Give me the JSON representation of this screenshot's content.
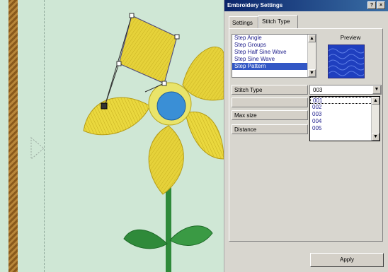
{
  "window": {
    "title": "Embroidery Settings",
    "help_glyph": "?",
    "close_glyph": "×"
  },
  "tabs": [
    {
      "label": "Settings",
      "active": false
    },
    {
      "label": "Stitch Type",
      "active": true
    }
  ],
  "pattern_list": {
    "items": [
      "Step Angle",
      "Step Groups",
      "Step Half Sine Wave",
      "Step Sine Wave",
      "Step Pattern"
    ],
    "selected_index": 4,
    "scroll_up_glyph": "▲",
    "scroll_down_glyph": "▼"
  },
  "preview": {
    "label": "Preview",
    "color": "#1f3fbf"
  },
  "properties": {
    "stitch_type": {
      "label": "Stitch Type",
      "value": "003",
      "arrow_glyph": "▼"
    },
    "blank_row": {
      "label": "",
      "value": ""
    },
    "max_size": {
      "label": "Max size",
      "value": ""
    },
    "distance": {
      "label": "Distance",
      "value": ""
    }
  },
  "dropdown": {
    "options": [
      "001",
      "002",
      "003",
      "004",
      "005"
    ],
    "highlight_index": 0,
    "scroll_up_glyph": "▲",
    "scroll_down_glyph": "▼"
  },
  "apply_label": "Apply",
  "colors": {
    "canvas_bg": "#cfe7d5",
    "petal_yellow": "#e6d23a",
    "center_blue": "#3a8fd6",
    "leaf_green": "#2f8a3a",
    "selection_blue": "#3257c5",
    "titlebar": "#0a246a"
  }
}
